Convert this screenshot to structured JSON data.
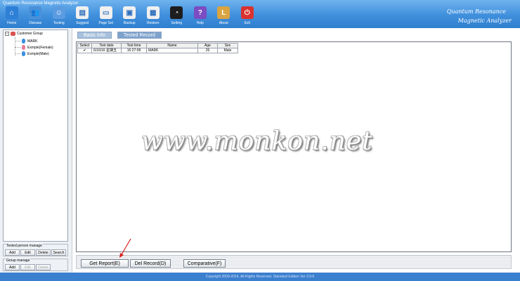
{
  "app": {
    "title": "Quantum Resonance Magnetic Analyzer",
    "brand_line1": "Quantum Resonance",
    "brand_line2": "Magnetic Analyzer"
  },
  "toolbar": [
    {
      "label": "Home",
      "icon": "home-icon",
      "color": "#2e7fd6",
      "glyph": "⌂"
    },
    {
      "label": "Disease",
      "icon": "people-icon",
      "color": "#4a90d9",
      "glyph": "👥"
    },
    {
      "label": "Testing",
      "icon": "tester-icon",
      "color": "#5b9be0",
      "glyph": "☺"
    },
    {
      "label": "Suggest",
      "icon": "clipboard-icon",
      "color": "#f0f0f0",
      "glyph": "▤"
    },
    {
      "label": "Page Set",
      "icon": "page-setup-icon",
      "color": "#f0f0f0",
      "glyph": "▭"
    },
    {
      "label": "Backup",
      "icon": "backup-icon",
      "color": "#f0f0f0",
      "glyph": "▣"
    },
    {
      "label": "Restore",
      "icon": "restore-icon",
      "color": "#f0f0f0",
      "glyph": "▦"
    },
    {
      "label": "Setting",
      "icon": "gauge-icon",
      "color": "#1d1d1d",
      "glyph": "◔"
    },
    {
      "label": "Help",
      "icon": "help-icon",
      "color": "#7b4cc2",
      "glyph": "?"
    },
    {
      "label": "About",
      "icon": "about-icon",
      "color": "#d9a441",
      "glyph": "L"
    },
    {
      "label": "Exit",
      "icon": "power-icon",
      "color": "#d9332f",
      "glyph": "⏻"
    }
  ],
  "tree": {
    "root": "Customer Group",
    "children": [
      {
        "label": "MARK",
        "color": "#3a8fe0"
      },
      {
        "label": "Exmple(Female)",
        "color": "#e87c9a"
      },
      {
        "label": "Exmple(Male)",
        "color": "#3a8fe0"
      }
    ]
  },
  "tested_person": {
    "title": "Tested person manage",
    "buttons": [
      "Add",
      "Edit",
      "Delete",
      "Search"
    ]
  },
  "group_manage": {
    "title": "Group manage",
    "buttons": [
      "Add",
      "Edit",
      "Delete"
    ]
  },
  "tabs": [
    "Basic Info",
    "Tested Record"
  ],
  "grid": {
    "columns": [
      "Select",
      "Test date",
      "Test time",
      "Name",
      "Age",
      "Sex"
    ],
    "rows": [
      {
        "select": "✔",
        "date": "6/16/16 星期五",
        "time": "16:27:08",
        "name": "MARK",
        "age": "26",
        "sex": "Male"
      }
    ]
  },
  "watermark": "www.monkon.net",
  "actions": {
    "get_report": "Get Report(E)",
    "del_record": "Del Record(D)",
    "comparative": "Comparative(F)"
  },
  "footer": "Copyright 2009-2016, All Rights Reserved. Standard Edition Ver 3.9.6"
}
